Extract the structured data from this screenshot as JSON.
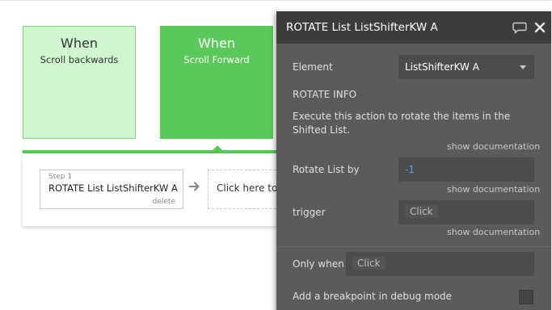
{
  "events": [
    {
      "title": "When",
      "subtitle": "Scroll backwards"
    },
    {
      "title": "When",
      "subtitle": "Scroll Forward"
    }
  ],
  "workflow": {
    "step_label": "Step 1",
    "step_title": "ROTATE List ListShifterKW A",
    "delete_label": "delete",
    "add_action_label": "Click here to add an action..."
  },
  "panel": {
    "title": "ROTATE List ListShifterKW A",
    "element_label": "Element",
    "element_value": "ListShifterKW A",
    "section_heading": "ROTATE INFO",
    "description": "Execute this action to rotate the items in the Shifted List.",
    "show_documentation": "show documentation",
    "rotate_label": "Rotate List by",
    "rotate_value": "-1",
    "trigger_label": "trigger",
    "trigger_placeholder": "Click",
    "only_when_label": "Only when",
    "only_when_placeholder": "Click",
    "breakpoint_label": "Add a breakpoint in debug mode"
  },
  "colors": {
    "event_light": "#cff6cf",
    "event_active": "#5ac85a",
    "panel_bg": "#5b5b5b",
    "panel_header": "#3c3c3c",
    "value_blue": "#5b9dff"
  }
}
